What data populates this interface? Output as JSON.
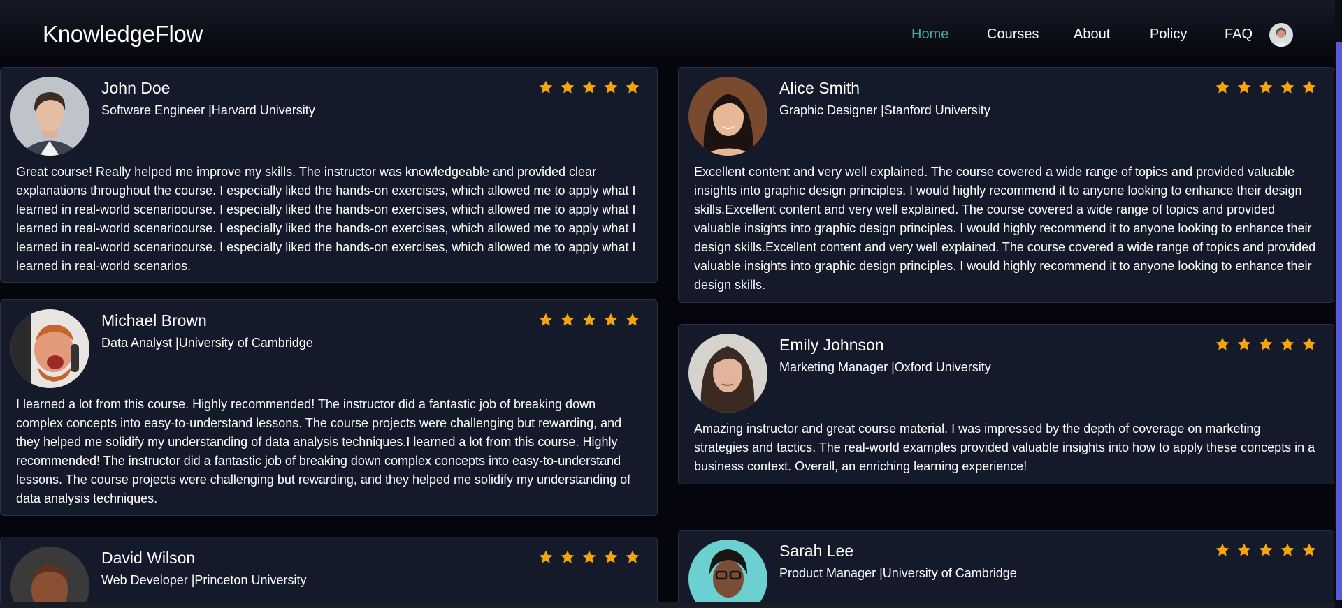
{
  "brand": "KnowledgeFlow",
  "nav": {
    "home": "Home",
    "courses": "Courses",
    "about": "About",
    "policy": "Policy",
    "faq": "FAQ"
  },
  "colors": {
    "accent": "#4aa3a0",
    "star": "#f4a40c",
    "card_bg": "#151a2a",
    "page_bg": "#05060d",
    "scrollbar": "#5a5bd6"
  },
  "rating_icon": "star-icon",
  "testimonials": [
    {
      "name": "John Doe",
      "role": "Software Engineer |Harvard University",
      "rating": 5,
      "review": "Great course! Really helped me improve my skills. The instructor was knowledgeable and provided clear explanations throughout the course. I especially liked the hands-on exercises, which allowed me to apply what I learned in real-world scenarioourse. I especially liked the hands-on exercises, which allowed me to apply what I learned in real-world scenarioourse. I especially liked the hands-on exercises, which allowed me to apply what I learned in real-world scenarioourse. I especially liked the hands-on exercises, which allowed me to apply what I learned in real-world scenarios."
    },
    {
      "name": "Alice Smith",
      "role": "Graphic Designer |Stanford University",
      "rating": 5,
      "review": "Excellent content and very well explained. The course covered a wide range of topics and provided valuable insights into graphic design principles. I would highly recommend it to anyone looking to enhance their design skills.Excellent content and very well explained. The course covered a wide range of topics and provided valuable insights into graphic design principles. I would highly recommend it to anyone looking to enhance their design skills.Excellent content and very well explained. The course covered a wide range of topics and provided valuable insights into graphic design principles. I would highly recommend it to anyone looking to enhance their design skills."
    },
    {
      "name": "Michael Brown",
      "role": "Data Analyst |University of Cambridge",
      "rating": 5,
      "review": "I learned a lot from this course. Highly recommended! The instructor did a fantastic job of breaking down complex concepts into easy-to-understand lessons. The course projects were challenging but rewarding, and they helped me solidify my understanding of data analysis techniques.I learned a lot from this course. Highly recommended! The instructor did a fantastic job of breaking down complex concepts into easy-to-understand lessons. The course projects were challenging but rewarding, and they helped me solidify my understanding of data analysis techniques."
    },
    {
      "name": "Emily Johnson",
      "role": "Marketing Manager |Oxford University",
      "rating": 5,
      "review": "Amazing instructor and great course material. I was impressed by the depth of coverage on marketing strategies and tactics. The real-world examples provided valuable insights into how to apply these concepts in a business context. Overall, an enriching learning experience!"
    },
    {
      "name": "David Wilson",
      "role": "Web Developer |Princeton University",
      "rating": 5,
      "review": ""
    },
    {
      "name": "Sarah Lee",
      "role": "Product Manager |University of Cambridge",
      "rating": 5,
      "review": ""
    }
  ]
}
